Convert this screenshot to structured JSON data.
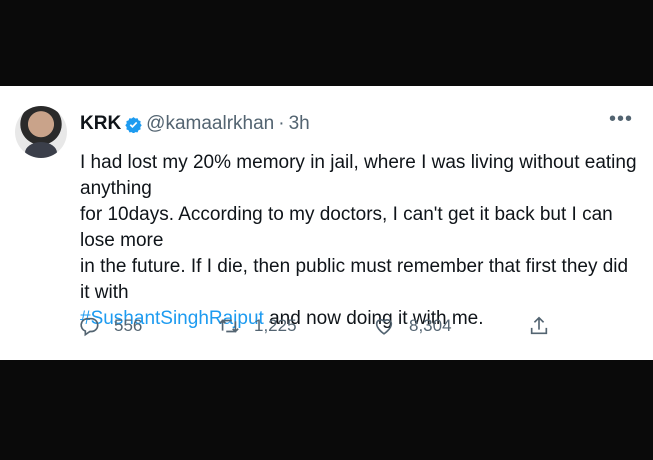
{
  "tweet": {
    "author": {
      "display_name": "KRK",
      "handle": "@kamaalrkhan",
      "separator": "·",
      "time": "3h",
      "verified": true
    },
    "more_icon": "more-dots-icon",
    "lines": [
      "I had lost my 20% memory in jail, where I was living without eating anything",
      "for 10days. According to my doctors, I can't get it back but I can lose more",
      "in the future. If I die, then public must remember that first they did it with"
    ],
    "hashtag": "#SushantSinghRajput",
    "last_line_rest": " and now doing it with me.",
    "actions": {
      "replies": "556",
      "retweets": "1,225",
      "likes": "8,304"
    },
    "colors": {
      "accent": "#1d9bf0",
      "text": "#0f1419",
      "secondary": "#536471",
      "frame": "#0a0a0a"
    }
  }
}
